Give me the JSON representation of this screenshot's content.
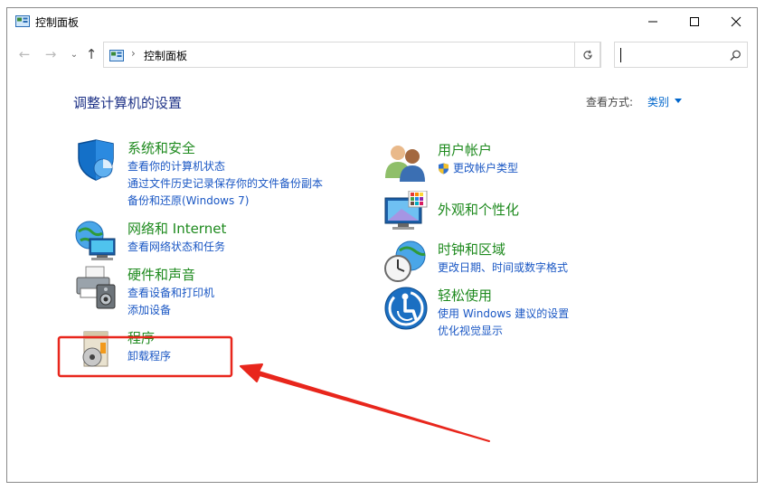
{
  "window": {
    "title": "控制面板",
    "controls": {
      "minimize": "minimize-icon",
      "maximize": "maximize-icon",
      "close": "close-icon"
    }
  },
  "navbar": {
    "address_path": "控制面板",
    "search_placeholder": ""
  },
  "content": {
    "heading": "调整计算机的设置",
    "view_by_label": "查看方式:",
    "view_by_value": "类别"
  },
  "categories_left": [
    {
      "title": "系统和安全",
      "icon": "shield-icon",
      "links": [
        "查看你的计算机状态",
        "通过文件历史记录保存你的文件备份副本",
        "备份和还原(Windows 7)"
      ]
    },
    {
      "title": "网络和 Internet",
      "icon": "network-globe-icon",
      "links": [
        "查看网络状态和任务"
      ]
    },
    {
      "title": "硬件和声音",
      "icon": "printer-speaker-icon",
      "links": [
        "查看设备和打印机",
        "添加设备"
      ]
    },
    {
      "title": "程序",
      "icon": "programs-disc-icon",
      "links": [
        "卸载程序"
      ]
    }
  ],
  "categories_right": [
    {
      "title": "用户帐户",
      "icon": "users-icon",
      "links": [
        "更改帐户类型"
      ]
    },
    {
      "title": "外观和个性化",
      "icon": "monitor-palette-icon",
      "links": []
    },
    {
      "title": "时钟和区域",
      "icon": "clock-globe-icon",
      "links": [
        "更改日期、时间或数字格式"
      ]
    },
    {
      "title": "轻松使用",
      "icon": "accessibility-icon",
      "links": [
        "使用 Windows 建议的设置",
        "优化视觉显示"
      ]
    }
  ],
  "annotation": {
    "highlight_color": "#e8261c"
  }
}
